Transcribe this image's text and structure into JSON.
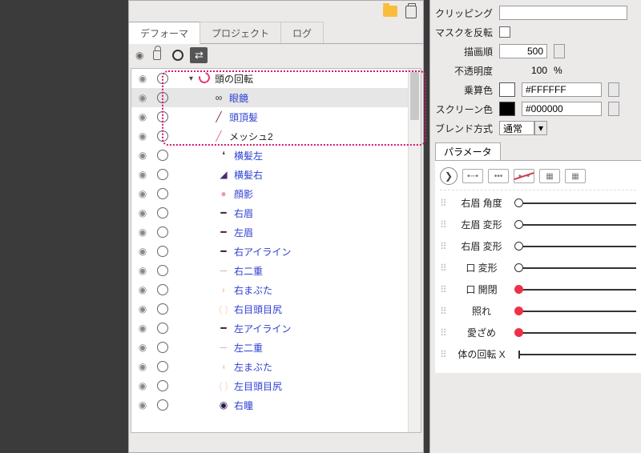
{
  "tabs": {
    "deformer": "デフォーマ",
    "project": "プロジェクト",
    "log": "ログ"
  },
  "tree": {
    "root": "頭の回転",
    "items": [
      {
        "label": "眼鏡",
        "icon": "∞",
        "color": "#333",
        "indent": 42,
        "selected": true
      },
      {
        "label": "頭頂髪",
        "icon": "╱",
        "color": "#7a2a4a",
        "indent": 42
      },
      {
        "label": "メッシュ2",
        "icon": "╱",
        "color": "#e06aa0",
        "indent": 42,
        "black": true
      },
      {
        "label": "横髪左",
        "icon": "❛",
        "color": "#4b2a6a",
        "indent": 48
      },
      {
        "label": "横髪右",
        "icon": "◢",
        "color": "#4b2a6a",
        "indent": 48
      },
      {
        "label": "顔影",
        "icon": "●",
        "color": "#f09ab0",
        "indent": 48
      },
      {
        "label": "右眉",
        "icon": "━",
        "color": "#4a2130",
        "indent": 48
      },
      {
        "label": "左眉",
        "icon": "━",
        "color": "#4a2130",
        "indent": 48
      },
      {
        "label": "右アイライン",
        "icon": "━",
        "color": "#3a1a2a",
        "indent": 48
      },
      {
        "label": "右二重",
        "icon": "─",
        "color": "#caa8b0",
        "indent": 48
      },
      {
        "label": "右まぶた",
        "icon": "◗",
        "color": "#f9d7c2",
        "indent": 48
      },
      {
        "label": "右目頭目尻",
        "icon": "( )",
        "color": "#f9d7c2",
        "indent": 48
      },
      {
        "label": "左アイライン",
        "icon": "━",
        "color": "#3a1a2a",
        "indent": 48
      },
      {
        "label": "左二重",
        "icon": "─",
        "color": "#caa8b0",
        "indent": 48
      },
      {
        "label": "左まぶた",
        "icon": "◖",
        "color": "#f9d7c2",
        "indent": 48
      },
      {
        "label": "左目頭目尻",
        "icon": "( )",
        "color": "#f9d7c2",
        "indent": 48
      },
      {
        "label": "右瞳",
        "icon": "◉",
        "color": "#2a1a50",
        "indent": 48
      }
    ]
  },
  "props": {
    "clipping_label": "クリッピング",
    "maskinv_label": "マスクを反転",
    "draworder_label": "描画順",
    "draworder_value": "500",
    "opacity_label": "不透明度",
    "opacity_value": "100",
    "opacity_unit": "%",
    "multiply_label": "乗算色",
    "multiply_value": "#FFFFFF",
    "screen_label": "スクリーン色",
    "screen_value": "#000000",
    "blend_label": "ブレンド方式",
    "blend_value": "通常"
  },
  "param": {
    "title": "パラメータ",
    "rows": [
      {
        "label": "右眉 角度",
        "knob": 0,
        "red": false
      },
      {
        "label": "左眉 変形",
        "knob": 0,
        "red": false
      },
      {
        "label": "右眉 変形",
        "knob": 0,
        "red": false
      },
      {
        "label": "口 変形",
        "knob": 0,
        "red": false
      },
      {
        "label": "口 開閉",
        "knob": 0,
        "red": true
      },
      {
        "label": "照れ",
        "knob": 0,
        "red": true
      },
      {
        "label": "愛ざめ",
        "knob": 0,
        "red": true
      },
      {
        "label": "体の回転 X",
        "knob": null,
        "red": false
      }
    ]
  }
}
